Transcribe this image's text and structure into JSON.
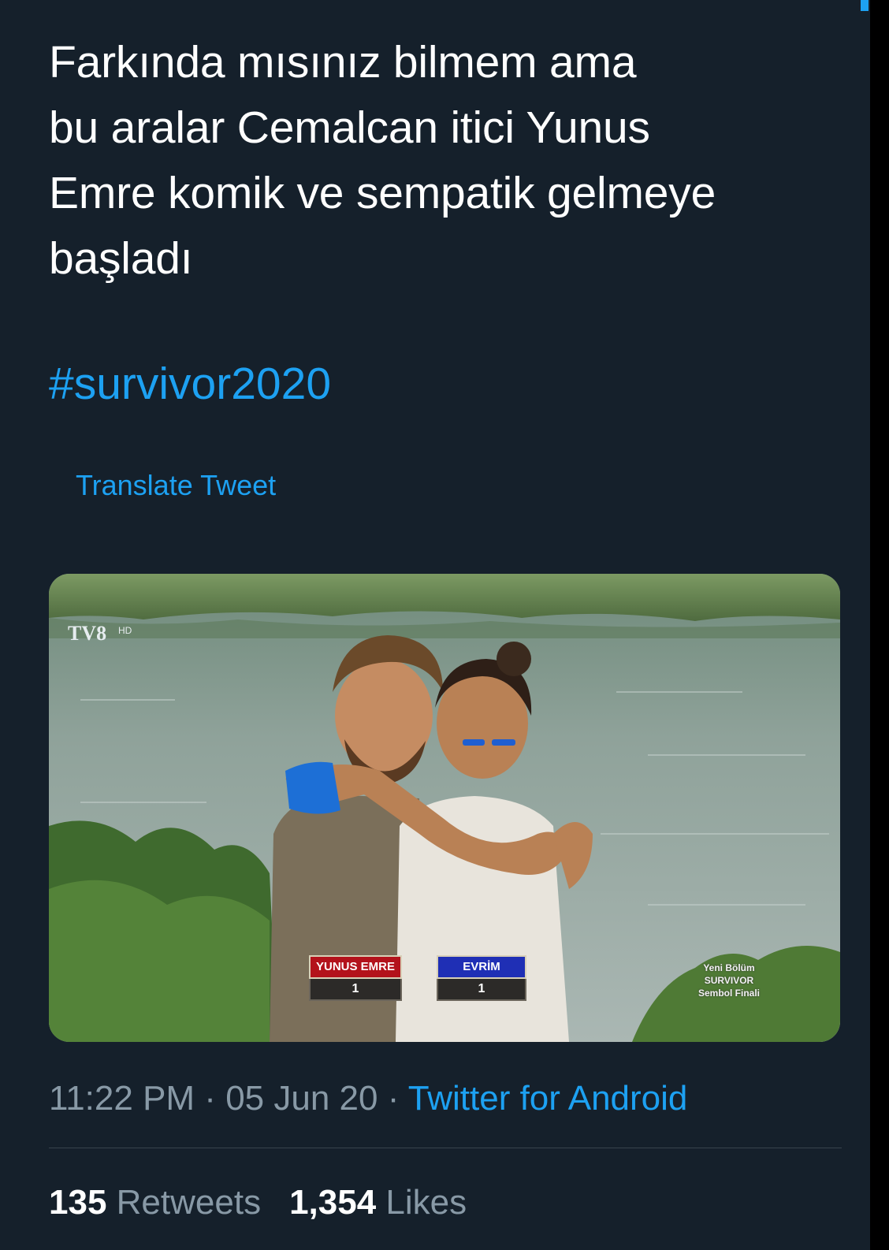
{
  "tweet": {
    "lines": [
      "Farkında mısınız bilmem ama",
      "bu aralar Cemalcan itici Yunus",
      "Emre komik ve sempatik gelmeye",
      "başladı"
    ],
    "hashtag": "#survivor2020",
    "translate_label": "Translate Tweet"
  },
  "media": {
    "channel_logo": "TV8",
    "channel_suffix": "HD",
    "scoreboard": [
      {
        "name": "YUNUS EMRE",
        "score": "1",
        "color": "#b3121b"
      },
      {
        "name": "EVRİM",
        "score": "1",
        "color": "#1f2fb5"
      }
    ],
    "promo": [
      "Yeni Bölüm",
      "SURVIVOR",
      "Sembol Finali"
    ]
  },
  "meta": {
    "time": "11:22 PM",
    "separator": " · ",
    "date": "05 Jun 20",
    "source": "Twitter for Android"
  },
  "stats": {
    "retweets_count": "135",
    "retweets_label": "Retweets",
    "likes_count": "1,354",
    "likes_label": "Likes"
  },
  "colors": {
    "background": "#15202b",
    "accent": "#1da1f2",
    "secondary_text": "#8899a6",
    "divider": "#38444d"
  }
}
